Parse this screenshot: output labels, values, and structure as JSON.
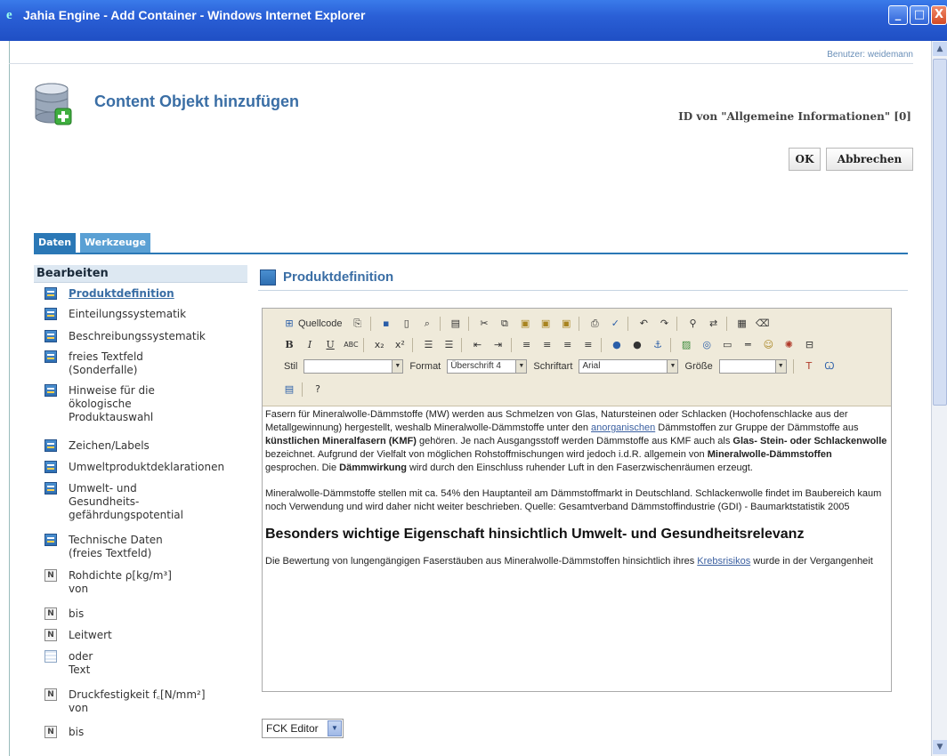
{
  "window": {
    "title": "Jahia Engine - Add Container - Windows Internet Explorer",
    "buttons": {
      "minimize": "_",
      "maximize": "□",
      "close": "X"
    }
  },
  "header": {
    "user_label": "Benutzer: weidemann",
    "page_title": "Content Objekt hinzufügen",
    "container_id": "ID von \"Allgemeine Informationen\" [0]",
    "ok_label": "OK",
    "cancel_label": "Abbrechen"
  },
  "tabs": [
    {
      "label": "Daten",
      "active": true
    },
    {
      "label": "Werkzeuge",
      "active": false
    }
  ],
  "sidebar": {
    "heading": "Bearbeiten",
    "items": [
      {
        "icon": "grid-icon",
        "lines": [
          "Produktdefinition"
        ],
        "selected": true
      },
      {
        "icon": "grid-icon",
        "lines": [
          "Einteilungssystematik"
        ]
      },
      {
        "icon": "grid-icon",
        "lines": [
          "Beschreibungssystematik"
        ]
      },
      {
        "icon": "grid-icon",
        "lines": [
          "freies Textfeld",
          "(Sonderfalle)"
        ]
      },
      {
        "icon": "grid-icon",
        "lines": [
          "Hinweise für die",
          "ökologische",
          "Produktauswahl"
        ]
      },
      {
        "icon": "grid-icon",
        "lines": [
          "Zeichen/Labels"
        ]
      },
      {
        "icon": "grid-icon",
        "lines": [
          "Umweltproduktdeklarationen"
        ]
      },
      {
        "icon": "grid-icon",
        "lines": [
          "Umwelt- und",
          "Gesundheits-",
          "gefährdungspotential"
        ]
      },
      {
        "icon": "grid-icon",
        "lines": [
          "Technische Daten",
          "(freies Textfeld)"
        ]
      },
      {
        "icon": "number-icon",
        "lines": [
          "Rohdichte ρ[kg/m³]",
          "von"
        ]
      },
      {
        "icon": "number-icon",
        "lines": [
          "bis"
        ]
      },
      {
        "icon": "number-icon",
        "lines": [
          "Leitwert"
        ]
      },
      {
        "icon": "list-icon",
        "lines": [
          "oder",
          "Text"
        ]
      },
      {
        "icon": "number-icon",
        "lines": [
          "Druckfestigkeit f꜀[N/mm²]",
          "von"
        ]
      },
      {
        "icon": "number-icon",
        "lines": [
          "bis"
        ]
      }
    ]
  },
  "section": {
    "title": "Produktdefinition"
  },
  "editor": {
    "source_label": "Quellcode",
    "style_label": "Stil",
    "style_value": "",
    "format_label": "Format",
    "format_value": "Überschrift 4",
    "font_label": "Schriftart",
    "font_value": "Arial",
    "size_label": "Größe",
    "size_value": "",
    "paragraph1": {
      "part1": "Fasern für Mineralwolle-Dämmstoffe (MW) werden aus Schmelzen von Glas, Natursteinen oder Schlacken (Hochofenschlacke aus der Metallgewinnung) hergestellt, weshalb Mineralwolle-Dämmstoffe unter den ",
      "link1": "anorganischen",
      "part2": " Dämmstoffen zur Gruppe der Dämmstoffe aus ",
      "bold1": "künstlichen Mineralfasern (KMF)",
      "part3": " gehören. Je nach Ausgangsstoff werden Dämmstoffe aus KMF auch als ",
      "bold2": "Glas- Stein- oder Schlackenwolle",
      "part4": " bezeichnet. Aufgrund der Vielfalt von möglichen Rohstoffmischungen wird jedoch i.d.R. allgemein von ",
      "bold3": "Mineralwolle-Dämmstoffen",
      "part5": " gesprochen. Die ",
      "bold4": "Dämmwirkung",
      "part6": " wird durch den Einschluss ruhender Luft in den Faserzwischenräumen erzeugt."
    },
    "paragraph2": "Mineralwolle-Dämmstoffe stellen mit ca. 54% den Hauptanteil am Dämmstoffmarkt in Deutschland. Schlackenwolle findet im Baubereich kaum noch Verwendung und wird daher nicht weiter beschrieben. Quelle: Gesamtverband Dämmstoffindustrie (GDI) - Baumarktstatistik 2005",
    "heading": "Besonders wichtige Eigenschaft hinsichtlich Umwelt- und Gesundheitsrelevanz",
    "paragraph3_part1": "Die Bewertung von lungengängigen Faserstäuben aus Mineralwolle-Dämmstoffen hinsichtlich ihres ",
    "paragraph3_link": "Krebsrisikos",
    "paragraph3_part2": " wurde in der Vergangenheit"
  },
  "editor_select": {
    "value": "FCK Editor"
  }
}
